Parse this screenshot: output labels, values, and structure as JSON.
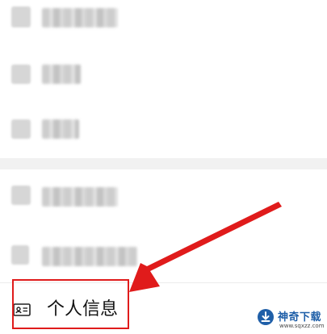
{
  "menu": {
    "items": [
      {
        "label": "个人信息",
        "icon": "id-card-icon"
      }
    ]
  },
  "watermark": {
    "title": "神奇下载",
    "url": "www.sqxzz.com"
  },
  "colors": {
    "highlight": "#e01b1b",
    "watermark_blue": "#1f5fa8"
  }
}
